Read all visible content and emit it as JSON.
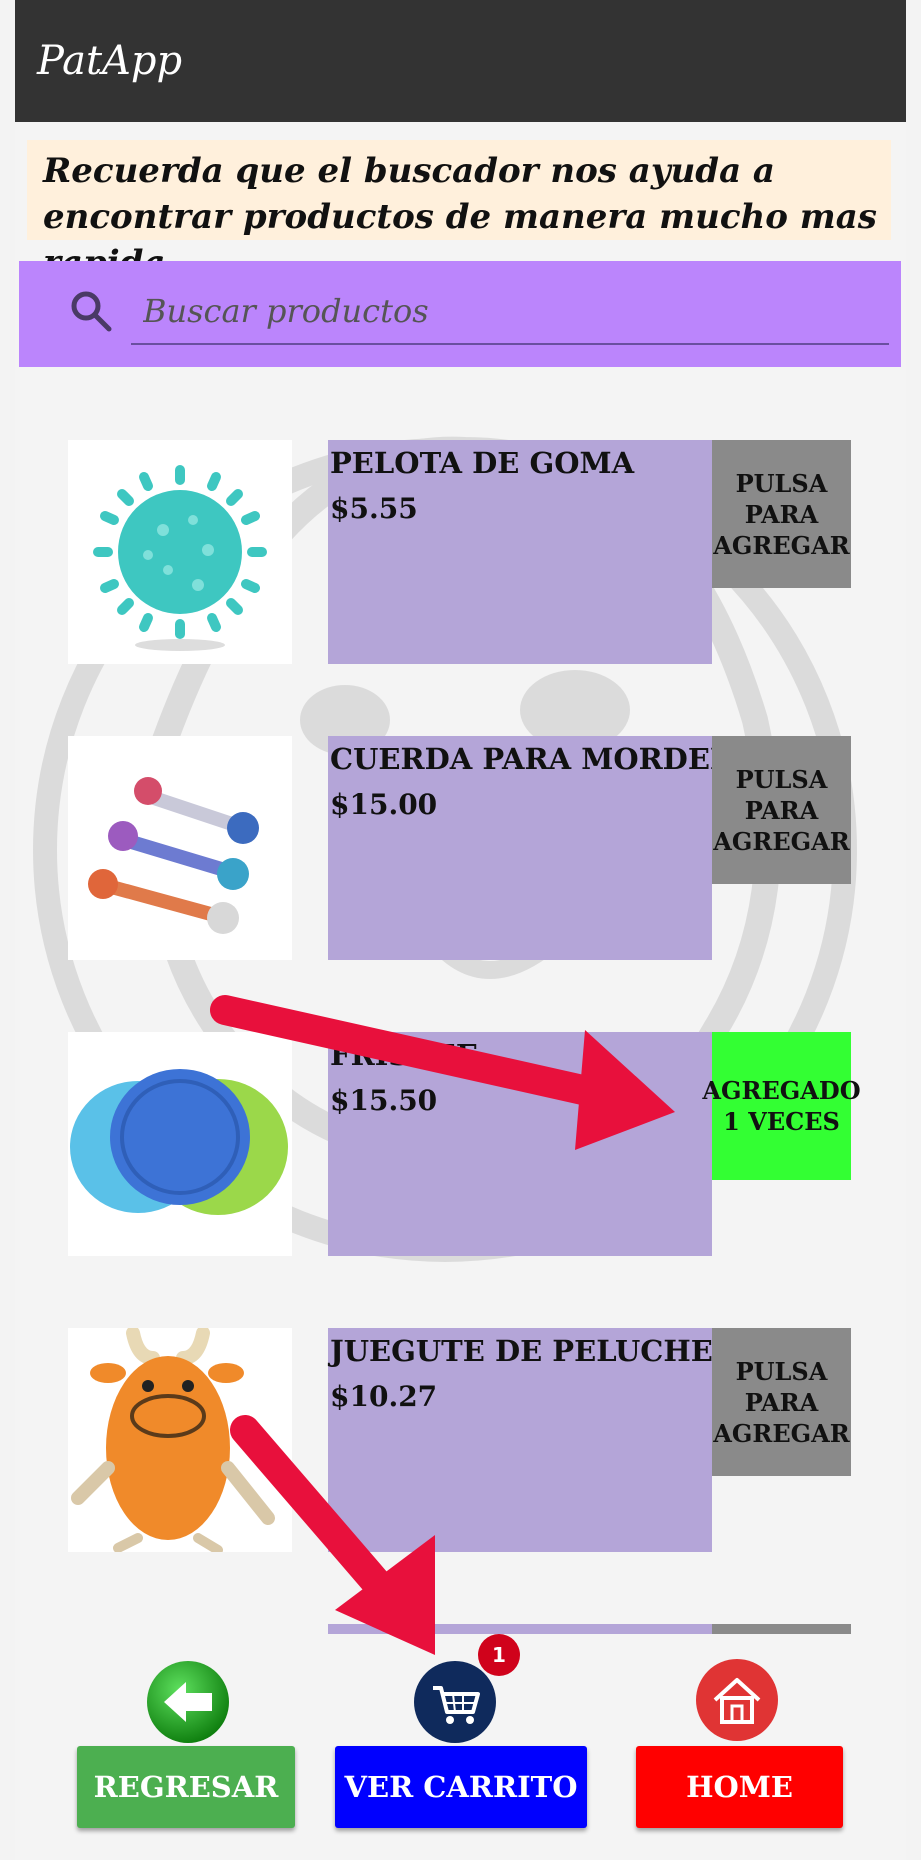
{
  "app": {
    "title": "PatApp"
  },
  "tip": {
    "text": "Recuerda que el buscador nos ayuda a encontrar productos de manera mucho mas rapida."
  },
  "search": {
    "placeholder": "Buscar productos",
    "icon": "search-icon"
  },
  "products": [
    {
      "name": "PELOTA DE GOMA",
      "price": "$5.55",
      "button": "PULSA\nPARA\nAGREGAR",
      "added": false,
      "image": "spiky-ball"
    },
    {
      "name": "CUERDA PARA MORDER",
      "price": "$15.00",
      "button": "PULSA\nPARA\nAGREGAR",
      "added": false,
      "image": "rope-toys"
    },
    {
      "name": "FRISBEE",
      "price": "$15.50",
      "button": "AGREGADO\n1 VECES",
      "added": true,
      "image": "frisbees"
    },
    {
      "name": "JUEGUTE DE PELUCHE",
      "price": "$10.27",
      "button": "PULSA\nPARA\nAGREGAR",
      "added": false,
      "image": "plush-cow"
    }
  ],
  "nav": {
    "back": {
      "label": "REGRESAR",
      "icon": "back-arrow-icon",
      "color": "#4caf50"
    },
    "cart": {
      "label": "VER CARRITO",
      "icon": "cart-icon",
      "badge": "1",
      "color": "#0000ff"
    },
    "home": {
      "label": "HOME",
      "icon": "home-icon",
      "color": "#ff0000"
    }
  },
  "colors": {
    "appbar": "#333333",
    "search_bg": "#bb85fc",
    "product_bg": "#b4a5d8",
    "add_button": "#8a8a8a",
    "added_button": "#33ff33",
    "annotation_arrow": "#e8103c"
  }
}
